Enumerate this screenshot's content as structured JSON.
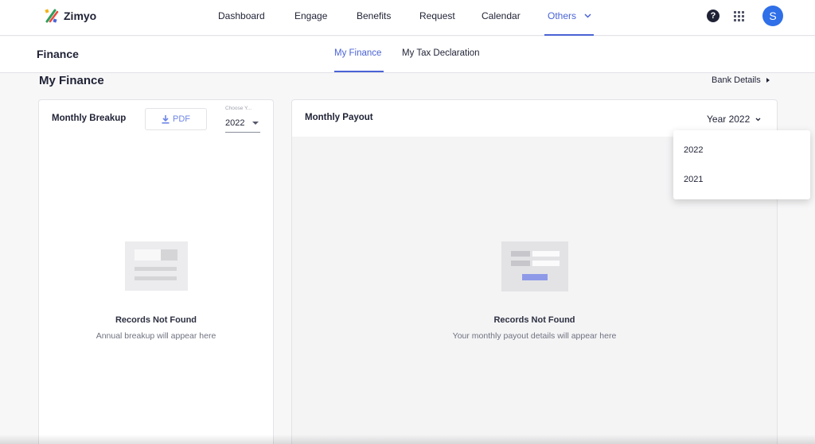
{
  "app": {
    "name": "Zimyo"
  },
  "nav": {
    "items": [
      {
        "label": "Dashboard"
      },
      {
        "label": "Engage"
      },
      {
        "label": "Benefits"
      },
      {
        "label": "Request"
      },
      {
        "label": "Calendar"
      },
      {
        "label": "Others"
      }
    ],
    "active": "Others"
  },
  "header_actions": {
    "help_icon": "?",
    "apps_icon": "grid-icon",
    "avatar_initial": "S"
  },
  "subheader": {
    "title": "Finance",
    "tabs": [
      {
        "label": "My Finance"
      },
      {
        "label": "My Tax Declaration"
      }
    ],
    "active_tab": "My Finance"
  },
  "page": {
    "title": "My Finance",
    "bank_details_link": "Bank Details"
  },
  "monthly_breakup": {
    "title": "Monthly Breakup",
    "pdf_button": "PDF",
    "year_select_label": "Choose Y...",
    "year_select_value": "2022",
    "empty_title": "Records Not Found",
    "empty_subtitle": "Annual breakup will appear here"
  },
  "monthly_payout": {
    "title": "Monthly Payout",
    "year_select_value": "Year 2022",
    "empty_title": "Records Not Found",
    "empty_subtitle": "Your monthly payout details will appear here"
  },
  "year_dropdown": {
    "options": [
      {
        "label": "2022"
      },
      {
        "label": "2021"
      }
    ]
  },
  "colors": {
    "accent": "#4a63d6",
    "avatar": "#2f6fe8",
    "pdf_text": "#6e86e6"
  }
}
